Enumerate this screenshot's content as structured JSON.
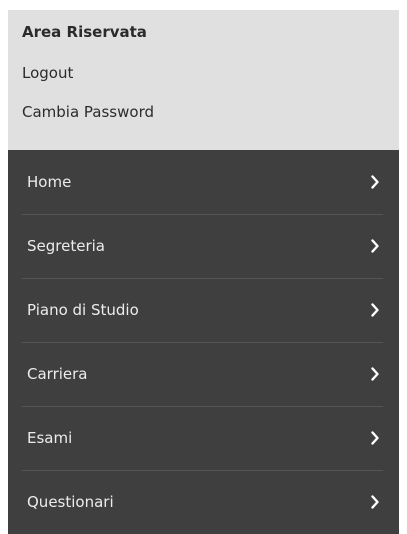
{
  "reserved_area": {
    "title": "Area Riservata",
    "logout_label": "Logout",
    "change_password_label": "Cambia Password"
  },
  "nav": {
    "items": [
      {
        "label": "Home",
        "icon": "chevron-right-icon"
      },
      {
        "label": "Segreteria",
        "icon": "chevron-right-icon"
      },
      {
        "label": "Piano di Studio",
        "icon": "chevron-right-icon"
      },
      {
        "label": "Carriera",
        "icon": "chevron-right-icon"
      },
      {
        "label": "Esami",
        "icon": "chevron-right-icon"
      },
      {
        "label": "Questionari",
        "icon": "chevron-right-icon"
      }
    ]
  },
  "colors": {
    "reserved_background": "#e0e0e0",
    "nav_background": "#3f3f3f",
    "nav_text": "#ececec",
    "divider": "#555555"
  }
}
